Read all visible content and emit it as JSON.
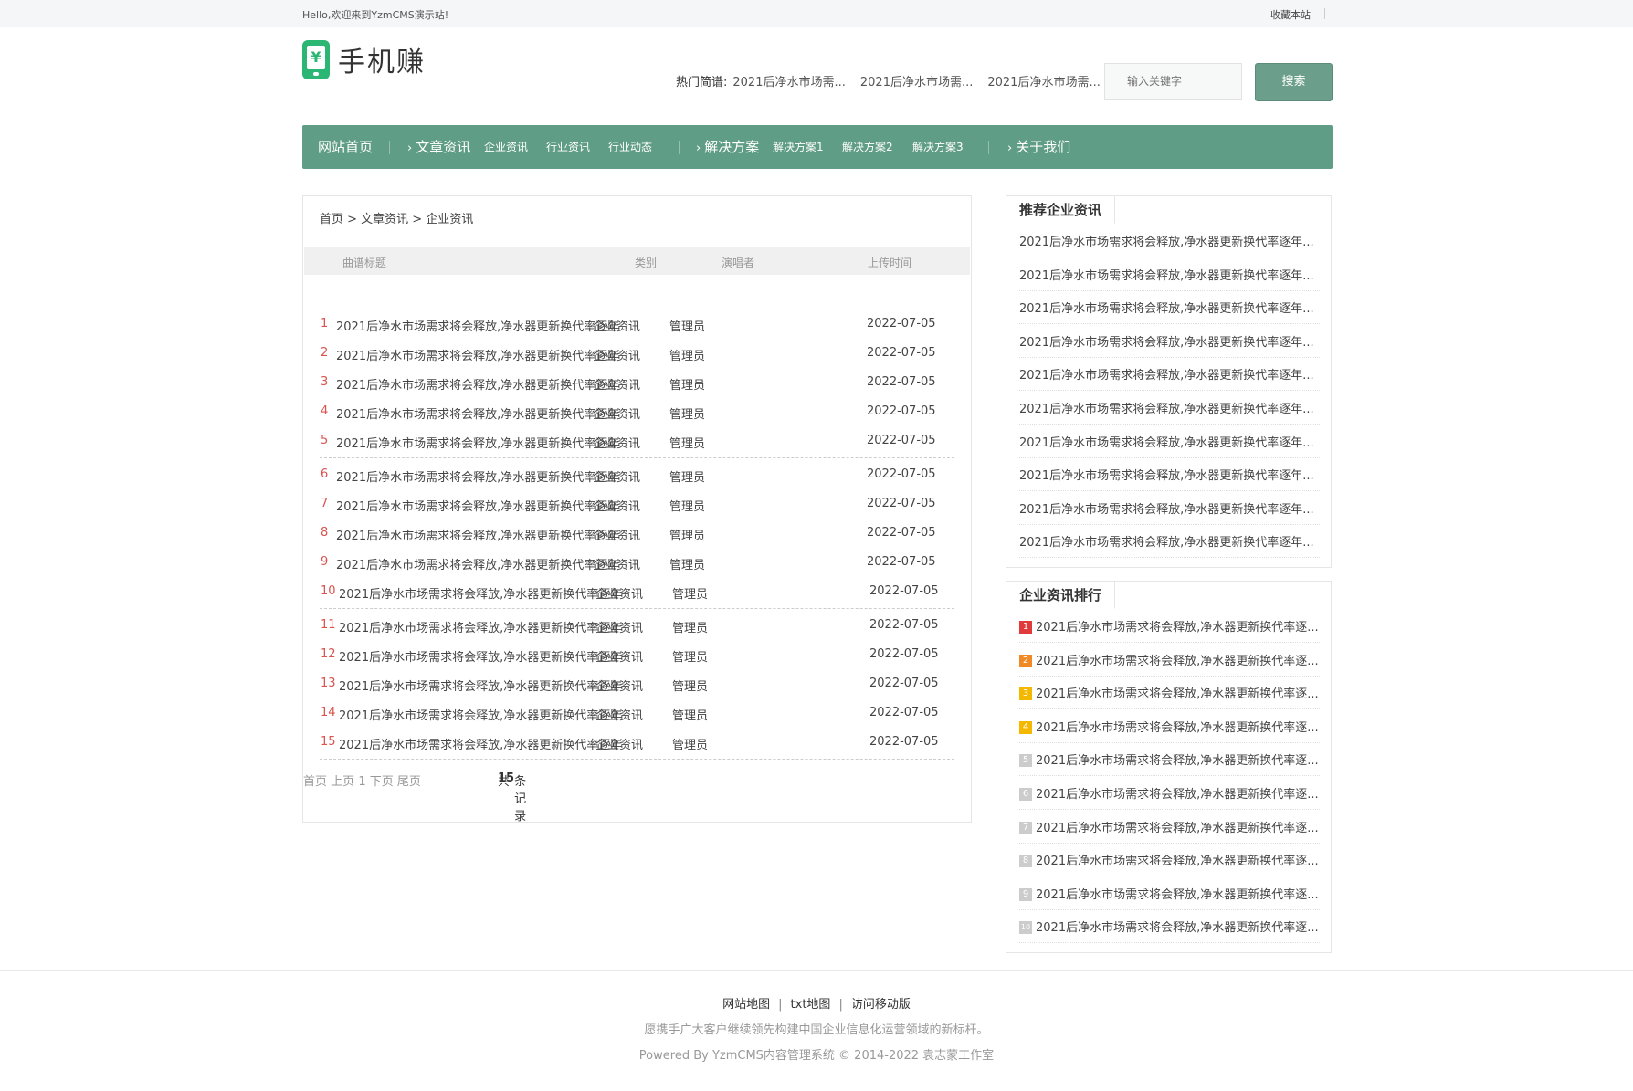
{
  "topbar": {
    "greeting": "Hello,欢迎来到YzmCMS演示站!",
    "favorite": "收藏本站"
  },
  "logo": {
    "symbol": "¥",
    "name": "手机赚"
  },
  "hot": {
    "label": "热门简谱:",
    "items": [
      "2021后净水市场需...",
      "2021后净水市场需...",
      "2021后净水市场需..."
    ]
  },
  "search": {
    "placeholder": "输入关键字",
    "button": "搜索"
  },
  "nav": {
    "home": "网站首页",
    "articles": "文章资讯",
    "articles_sub": [
      "企业资讯",
      "行业资讯",
      "行业动态"
    ],
    "solutions": "解决方案",
    "solutions_sub": [
      "解决方案1",
      "解决方案2",
      "解决方案3"
    ],
    "about": "关于我们"
  },
  "breadcrumb": "首页 > 文章资讯 > 企业资讯",
  "table": {
    "headers": [
      "曲谱标题",
      "类别",
      "演唱者",
      "上传时间"
    ],
    "rows": [
      {
        "num": "1",
        "title": "2021后净水市场需求将会释放,净水器更新换代率逐年",
        "cat": "企业资讯",
        "author": "管理员",
        "date": "2022-07-05"
      },
      {
        "num": "2",
        "title": "2021后净水市场需求将会释放,净水器更新换代率逐年",
        "cat": "企业资讯",
        "author": "管理员",
        "date": "2022-07-05"
      },
      {
        "num": "3",
        "title": "2021后净水市场需求将会释放,净水器更新换代率逐年",
        "cat": "企业资讯",
        "author": "管理员",
        "date": "2022-07-05"
      },
      {
        "num": "4",
        "title": "2021后净水市场需求将会释放,净水器更新换代率逐年",
        "cat": "企业资讯",
        "author": "管理员",
        "date": "2022-07-05"
      },
      {
        "num": "5",
        "title": "2021后净水市场需求将会释放,净水器更新换代率逐年",
        "cat": "企业资讯",
        "author": "管理员",
        "date": "2022-07-05"
      },
      {
        "num": "6",
        "title": "2021后净水市场需求将会释放,净水器更新换代率逐年",
        "cat": "企业资讯",
        "author": "管理员",
        "date": "2022-07-05"
      },
      {
        "num": "7",
        "title": "2021后净水市场需求将会释放,净水器更新换代率逐年",
        "cat": "企业资讯",
        "author": "管理员",
        "date": "2022-07-05"
      },
      {
        "num": "8",
        "title": "2021后净水市场需求将会释放,净水器更新换代率逐年",
        "cat": "企业资讯",
        "author": "管理员",
        "date": "2022-07-05"
      },
      {
        "num": "9",
        "title": "2021后净水市场需求将会释放,净水器更新换代率逐年",
        "cat": "企业资讯",
        "author": "管理员",
        "date": "2022-07-05"
      },
      {
        "num": "10",
        "title": "2021后净水市场需求将会释放,净水器更新换代率逐年",
        "cat": "企业资讯",
        "author": "管理员",
        "date": "2022-07-05"
      },
      {
        "num": "11",
        "title": "2021后净水市场需求将会释放,净水器更新换代率逐年",
        "cat": "企业资讯",
        "author": "管理员",
        "date": "2022-07-05"
      },
      {
        "num": "12",
        "title": "2021后净水市场需求将会释放,净水器更新换代率逐年",
        "cat": "企业资讯",
        "author": "管理员",
        "date": "2022-07-05"
      },
      {
        "num": "13",
        "title": "2021后净水市场需求将会释放,净水器更新换代率逐年",
        "cat": "企业资讯",
        "author": "管理员",
        "date": "2022-07-05"
      },
      {
        "num": "14",
        "title": "2021后净水市场需求将会释放,净水器更新换代率逐年",
        "cat": "企业资讯",
        "author": "管理员",
        "date": "2022-07-05"
      },
      {
        "num": "15",
        "title": "2021后净水市场需求将会释放,净水器更新换代率逐年",
        "cat": "企业资讯",
        "author": "管理员",
        "date": "2022-07-05"
      }
    ]
  },
  "pager": {
    "total_prefix": "共",
    "total_count": "15",
    "total_suffix": "条记录",
    "first": "首页",
    "prev": "上页",
    "current": "1",
    "next": "下页",
    "last": "尾页"
  },
  "recommend": {
    "title": "推荐企业资讯",
    "items": [
      "2021后净水市场需求将会释放,净水器更新换代率逐年...",
      "2021后净水市场需求将会释放,净水器更新换代率逐年...",
      "2021后净水市场需求将会释放,净水器更新换代率逐年...",
      "2021后净水市场需求将会释放,净水器更新换代率逐年...",
      "2021后净水市场需求将会释放,净水器更新换代率逐年...",
      "2021后净水市场需求将会释放,净水器更新换代率逐年...",
      "2021后净水市场需求将会释放,净水器更新换代率逐年...",
      "2021后净水市场需求将会释放,净水器更新换代率逐年...",
      "2021后净水市场需求将会释放,净水器更新换代率逐年...",
      "2021后净水市场需求将会释放,净水器更新换代率逐年..."
    ]
  },
  "ranking": {
    "title": "企业资讯排行",
    "colors": [
      "#e03a3a",
      "#f08a24",
      "#f5b800",
      "#f5b800",
      "#cccccc",
      "#cccccc",
      "#cccccc",
      "#cccccc",
      "#cccccc",
      "#cccccc"
    ],
    "items": [
      {
        "rank": "1",
        "text": "2021后净水市场需求将会释放,净水器更新换代率逐..."
      },
      {
        "rank": "2",
        "text": "2021后净水市场需求将会释放,净水器更新换代率逐..."
      },
      {
        "rank": "3",
        "text": "2021后净水市场需求将会释放,净水器更新换代率逐..."
      },
      {
        "rank": "4",
        "text": "2021后净水市场需求将会释放,净水器更新换代率逐..."
      },
      {
        "rank": "5",
        "text": "2021后净水市场需求将会释放,净水器更新换代率逐..."
      },
      {
        "rank": "6",
        "text": "2021后净水市场需求将会释放,净水器更新换代率逐..."
      },
      {
        "rank": "7",
        "text": "2021后净水市场需求将会释放,净水器更新换代率逐..."
      },
      {
        "rank": "8",
        "text": "2021后净水市场需求将会释放,净水器更新换代率逐..."
      },
      {
        "rank": "9",
        "text": "2021后净水市场需求将会释放,净水器更新换代率逐..."
      },
      {
        "rank": "10",
        "text": "2021后净水市场需求将会释放,净水器更新换代率逐..."
      }
    ]
  },
  "footer": {
    "links": [
      "网站地图",
      "txt地图",
      "访问移动版"
    ],
    "separator": "|",
    "slogan": "愿携手广大客户继续领先构建中国企业信息化运营领域的新标杆。",
    "copyright": "Powered By YzmCMS内容管理系统 © 2014-2022 袁志蒙工作室"
  },
  "theme": {
    "nav_bg": "#609d86",
    "button_bg": "#6b9f8b",
    "row_number": "#d9534f"
  }
}
